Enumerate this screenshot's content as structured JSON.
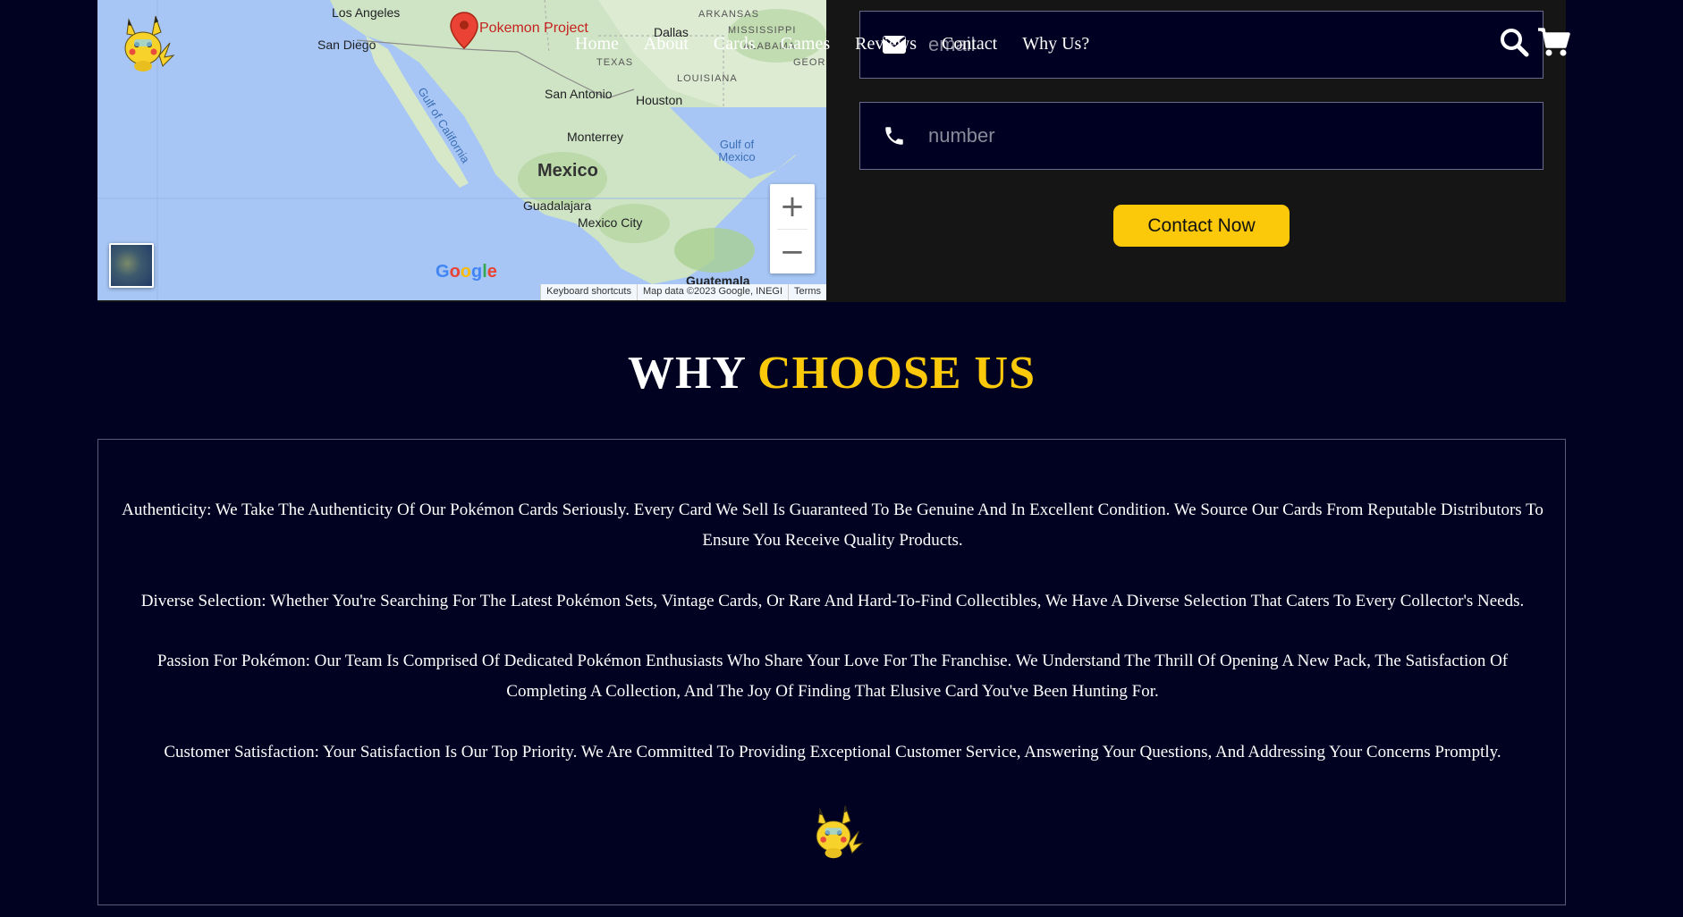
{
  "map": {
    "pin_label": "Pokemon Project",
    "cities": [
      "Los Angeles",
      "San Diego",
      "Dallas",
      "San Antonio",
      "Houston",
      "Monterrey",
      "Guadalajara",
      "Mexico City",
      "Guatemala"
    ],
    "states": [
      "ARKANSAS",
      "MISSISSIPPI",
      "TEXAS",
      "LOUISIANA",
      "ALABAMA",
      "GEORG"
    ],
    "country": "Mexico",
    "waters": [
      "Gulf of California",
      "Gulf of Mexico"
    ],
    "google_logo": "Google",
    "footer": {
      "shortcuts": "Keyboard shortcuts",
      "data": "Map data ©2023 Google, INEGI",
      "terms": "Terms"
    },
    "zoom_in": "+",
    "zoom_out": "−"
  },
  "nav": {
    "items": [
      "Home",
      "About",
      "Cards",
      "Games",
      "Reviews",
      "Contact",
      "Why Us?"
    ]
  },
  "form": {
    "email_placeholder": "email",
    "number_placeholder": "number",
    "submit_label": "Contact Now"
  },
  "why": {
    "heading_white": "WHY",
    "heading_yellow": "CHOOSE US",
    "points": [
      "Authenticity: We Take The Authenticity Of Our Pokémon Cards Seriously. Every Card We Sell Is Guaranteed To Be Genuine And In Excellent Condition. We Source Our Cards From Reputable Distributors To Ensure You Receive Quality Products.",
      "Diverse Selection: Whether You're Searching For The Latest Pokémon Sets, Vintage Cards, Or Rare And Hard-To-Find Collectibles, We Have A Diverse Selection That Caters To Every Collector's Needs.",
      "Passion For Pokémon: Our Team Is Comprised Of Dedicated Pokémon Enthusiasts Who Share Your Love For The Franchise. We Understand The Thrill Of Opening A New Pack, The Satisfaction Of Completing A Collection, And The Joy Of Finding That Elusive Card You've Been Hunting For.",
      "Customer Satisfaction: Your Satisfaction Is Our Top Priority. We Are Committed To Providing Exceptional Customer Service, Answering Your Questions, And Addressing Your Concerns Promptly."
    ]
  },
  "colors": {
    "background": "#010122",
    "accent": "#fbc80a",
    "panel": "#151515"
  },
  "icons": [
    "pikachu-logo",
    "search-icon",
    "cart-icon",
    "envelope-icon",
    "phone-icon",
    "map-pin-icon"
  ]
}
